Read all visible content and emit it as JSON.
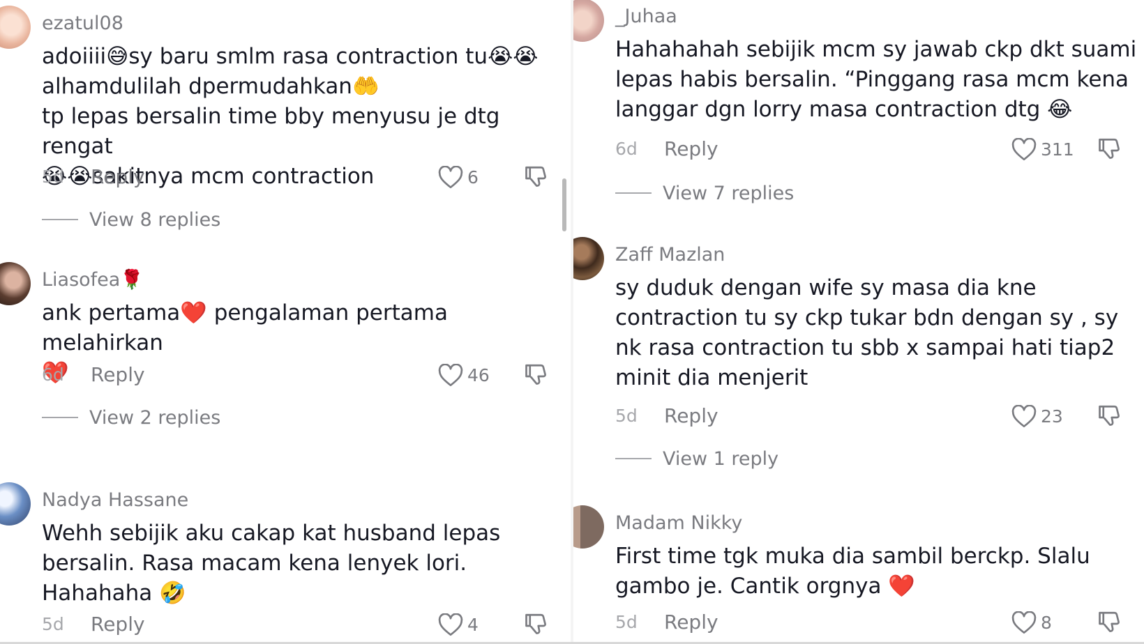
{
  "colors": {
    "username": "#7a7b80",
    "body_text": "#161823",
    "timestamp": "#a6a7ab"
  },
  "icons": {
    "like": "heart-outline",
    "dislike": "thumbs-down-outline"
  },
  "left_column": [
    {
      "username": "ezatul08",
      "text": "adoiiii😅sy baru smlm rasa contraction tu😭😭\nalhamdulilah dpermudahkan🤲\ntp lepas bersalin time bby menyusu je dtg rengat\n😭😭sakitnya mcm contraction",
      "time": "5d",
      "reply": "Reply",
      "likes": "6",
      "view_replies": "View 8 replies"
    },
    {
      "username": "Liasofea🌹",
      "text": "ank pertama❤️ pengalaman pertama melahirkan\n❤️",
      "time": "6d",
      "reply": "Reply",
      "likes": "46",
      "view_replies": "View 2 replies"
    },
    {
      "username": "Nadya Hassane",
      "text": "Wehh sebijik aku cakap kat husband lepas\nbersalin. Rasa macam kena lenyek lori.\nHahahaha 🤣",
      "time": "5d",
      "reply": "Reply",
      "likes": "4"
    }
  ],
  "right_column": [
    {
      "username": "_Juhaa",
      "text": "Hahahahah sebijik mcm sy jawab ckp dkt suami\nlepas habis bersalin. “Pinggang rasa mcm kena\nlanggar dgn lorry masa contraction dtg 😂",
      "time": "6d",
      "reply": "Reply",
      "likes": "311",
      "view_replies": "View 7 replies"
    },
    {
      "username": "Zaff Mazlan",
      "text": "sy duduk dengan wife sy masa dia kne\ncontraction tu sy ckp tukar bdn dengan sy , sy\nnk rasa contraction tu sbb x sampai hati tiap2\nminit dia menjerit",
      "time": "5d",
      "reply": "Reply",
      "likes": "23",
      "view_replies": "View 1 reply"
    },
    {
      "username": "Madam Nikky",
      "text": "First time tgk muka dia sambil berckp. Slalu\ngambo je. Cantik orgnya ❤️",
      "time": "5d",
      "reply": "Reply",
      "likes": "8"
    }
  ]
}
